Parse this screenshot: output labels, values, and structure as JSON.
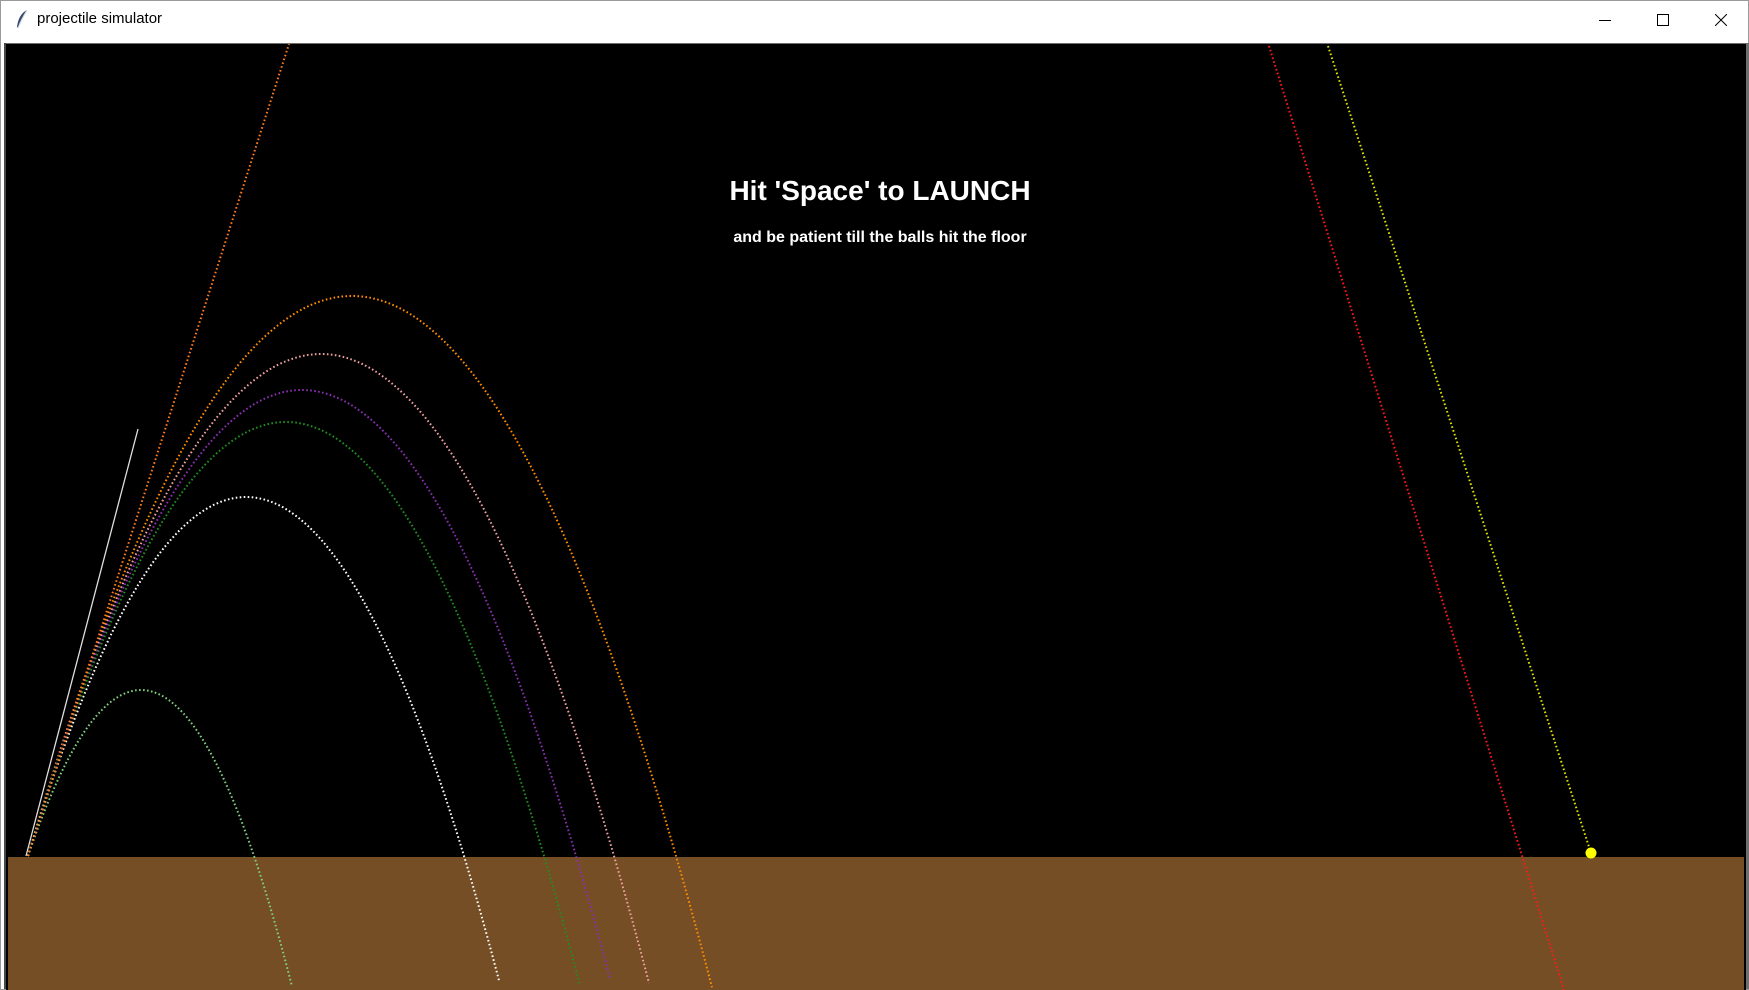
{
  "window": {
    "title": "projectile simulator",
    "app_icon": "feather-icon",
    "controls": [
      "minimize-icon",
      "maximize-icon",
      "close-icon"
    ]
  },
  "instructions": {
    "headline": "Hit 'Space' to LAUNCH",
    "subline": "and be patient till the balls hit the floor"
  },
  "scene": {
    "background_color": "#000000",
    "floor_color": "#754e26",
    "launcher_color": "#e0e0e0",
    "ball_color": "#ffff00",
    "trajectory_colors": [
      "#ff8c00",
      "#f0a0a0",
      "#8b2fb5",
      "#1f8f1f",
      "#ffffff",
      "#7fd07f",
      "#ff1a1a",
      "#e0e000"
    ]
  }
}
